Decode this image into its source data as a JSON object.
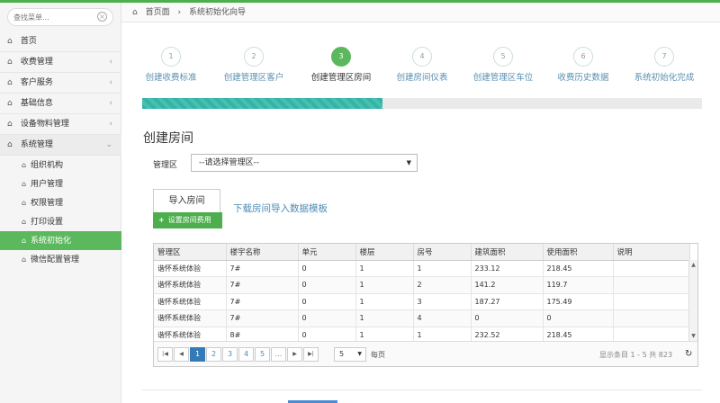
{
  "sidebar": {
    "search_placeholder": "查找菜单...",
    "menu": [
      {
        "label": "首页",
        "icon": "home-icon"
      },
      {
        "label": "收费管理",
        "icon": "house-icon"
      },
      {
        "label": "客户服务",
        "icon": "house-icon"
      },
      {
        "label": "基础信息",
        "icon": "house-icon"
      },
      {
        "label": "设备物料管理",
        "icon": "house-icon"
      },
      {
        "label": "系统管理",
        "icon": "house-icon"
      }
    ],
    "submenu": [
      "组织机构",
      "用户管理",
      "权限管理",
      "打印设置",
      "系统初始化",
      "微信配置管理"
    ]
  },
  "breadcrumb": {
    "home": "首页面",
    "current": "系统初始化向导"
  },
  "wizard": {
    "steps": [
      {
        "num": "1",
        "label": "创建收费标准"
      },
      {
        "num": "2",
        "label": "创建管理区客户"
      },
      {
        "num": "3",
        "label": "创建管理区房间"
      },
      {
        "num": "4",
        "label": "创建房间仪表"
      },
      {
        "num": "5",
        "label": "创建管理区车位"
      },
      {
        "num": "6",
        "label": "收费历史数据"
      },
      {
        "num": "7",
        "label": "系统初始化完成"
      }
    ],
    "active_step": 3,
    "progress_fraction": 0.43
  },
  "form": {
    "title": "创建房间",
    "area_label": "管理区",
    "area_select": "--请选择管理区--",
    "import_tab": "导入房间",
    "download_link": "下载房间导入数据模板",
    "set_fee_button": "设置房间费用"
  },
  "table": {
    "headers": [
      "管理区",
      "楼宇名称",
      "单元",
      "楼层",
      "房号",
      "建筑面积",
      "使用面积",
      "说明"
    ],
    "rows": [
      [
        "谐怀系统体验",
        "7#",
        "0",
        "1",
        "1",
        "233.12",
        "218.45",
        ""
      ],
      [
        "谐怀系统体验",
        "7#",
        "0",
        "1",
        "2",
        "141.2",
        "119.7",
        ""
      ],
      [
        "谐怀系统体验",
        "7#",
        "0",
        "1",
        "3",
        "187.27",
        "175.49",
        ""
      ],
      [
        "谐怀系统体验",
        "7#",
        "0",
        "1",
        "4",
        "0",
        "0",
        ""
      ],
      [
        "谐怀系统体验",
        "8#",
        "0",
        "1",
        "1",
        "232.52",
        "218.45",
        ""
      ]
    ]
  },
  "pager": {
    "pages": [
      "1",
      "2",
      "3",
      "4",
      "5",
      "..."
    ],
    "active_page": "1",
    "page_size": "5",
    "per_page_label": "每页",
    "info": "显示条目 1 - 5 共 823"
  }
}
